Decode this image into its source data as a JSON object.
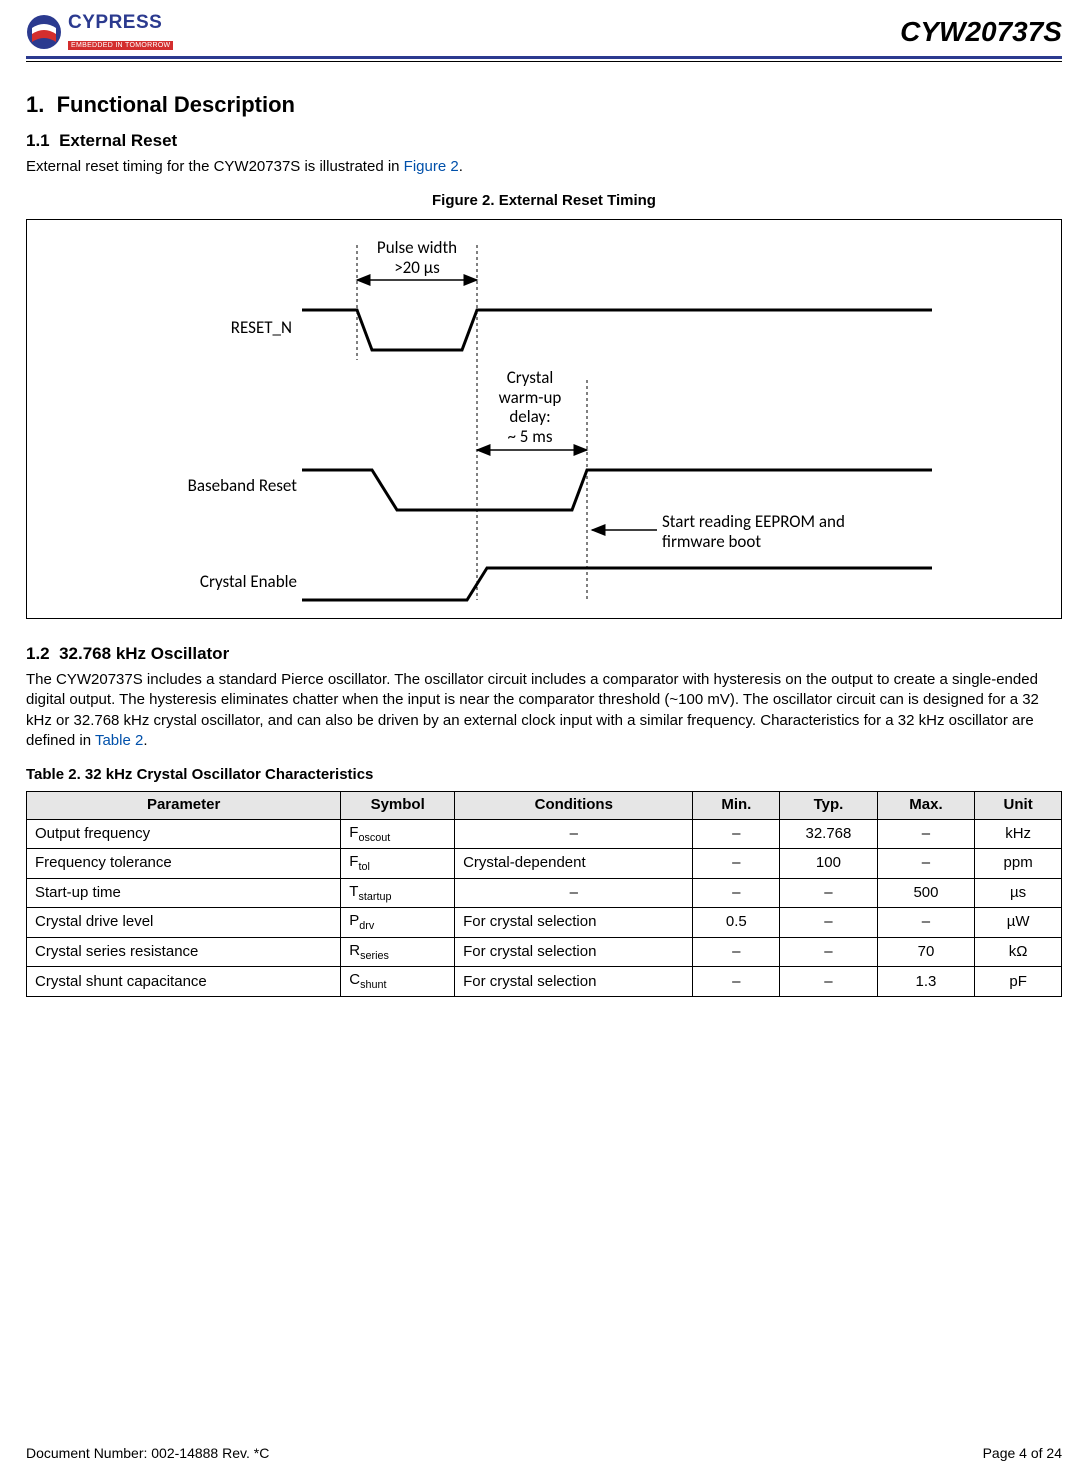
{
  "header": {
    "part_number": "CYW20737S",
    "logo_text": "CYPRESS",
    "logo_tag": "EMBEDDED IN TOMORROW"
  },
  "sections": {
    "s1_num": "1.",
    "s1_title": "Functional Description",
    "s11_num": "1.1",
    "s11_title": "External Reset",
    "s11_body_a": "External reset timing for the CYW20737S is illustrated in ",
    "s11_link": "Figure 2",
    "s11_body_b": ".",
    "s12_num": "1.2",
    "s12_title": "32.768 kHz Oscillator",
    "s12_body_a": "The CYW20737S includes a standard Pierce oscillator. The oscillator circuit includes a comparator with hysteresis on the output to create a single-ended digital output. The hysteresis eliminates chatter when the input is near the comparator threshold (~100 mV). The oscillator circuit can is designed for a 32 kHz or 32.768 kHz crystal oscillator, and can also be driven by an external clock input with a similar frequency. Characteristics for a 32 kHz oscillator are defined in ",
    "s12_link": "Table 2",
    "s12_body_b": "."
  },
  "figure": {
    "caption": "Figure 2. External Reset Timing",
    "labels": {
      "pulse_width": "Pulse width\n>20 µs",
      "reset_n": "RESET_N",
      "crystal_delay": "Crystal\nwarm-up\ndelay:\n~ 5 ms",
      "baseband_reset": "Baseband Reset",
      "start_reading": "Start reading EEPROM and\nfirmware boot",
      "crystal_enable": "Crystal Enable"
    }
  },
  "table": {
    "caption": "Table 2. 32 kHz Crystal Oscillator Characteristics",
    "headers": [
      "Parameter",
      "Symbol",
      "Conditions",
      "Min.",
      "Typ.",
      "Max.",
      "Unit"
    ],
    "rows": [
      {
        "param": "Output frequency",
        "sym_main": "F",
        "sym_sub": "oscout",
        "cond": "–",
        "min": "–",
        "typ": "32.768",
        "max": "–",
        "unit": "kHz"
      },
      {
        "param": "Frequency tolerance",
        "sym_main": "F",
        "sym_sub": "tol",
        "cond": "Crystal-dependent",
        "min": "–",
        "typ": "100",
        "max": "–",
        "unit": "ppm"
      },
      {
        "param": "Start-up time",
        "sym_main": "T",
        "sym_sub": "startup",
        "cond": "–",
        "min": "–",
        "typ": "–",
        "max": "500",
        "unit": "µs"
      },
      {
        "param": "Crystal drive level",
        "sym_main": "P",
        "sym_sub": "drv",
        "cond": "For crystal selection",
        "min": "0.5",
        "typ": "–",
        "max": "–",
        "unit": "µW"
      },
      {
        "param": "Crystal series resistance",
        "sym_main": "R",
        "sym_sub": "series",
        "cond": "For crystal selection",
        "min": "–",
        "typ": "–",
        "max": "70",
        "unit": "kΩ"
      },
      {
        "param": "Crystal shunt capacitance",
        "sym_main": "C",
        "sym_sub": "shunt",
        "cond": "For crystal selection",
        "min": "–",
        "typ": "–",
        "max": "1.3",
        "unit": "pF"
      }
    ]
  },
  "chart_data": {
    "type": "timing-diagram",
    "signals": [
      {
        "name": "RESET_N",
        "events": [
          "high",
          "fall",
          "low (>20 µs pulse width)",
          "rise",
          "high"
        ]
      },
      {
        "name": "Baseband Reset",
        "events": [
          "high",
          "fall (at RESET_N fall)",
          "low",
          "rise (after ~5 ms crystal warm-up from RESET_N rise)",
          "high"
        ]
      },
      {
        "name": "Crystal Enable",
        "events": [
          "low",
          "rise (at RESET_N rise)",
          "high"
        ]
      }
    ],
    "annotations": [
      {
        "text": "Pulse width >20 µs",
        "on": "RESET_N low duration"
      },
      {
        "text": "Crystal warm-up delay: ~ 5 ms",
        "between": [
          "RESET_N rise",
          "Baseband Reset rise"
        ]
      },
      {
        "text": "Start reading EEPROM and firmware boot",
        "at": "Baseband Reset rise"
      }
    ]
  },
  "footer": {
    "doc": "Document Number: 002-14888 Rev. *C",
    "page": "Page 4 of 24"
  }
}
